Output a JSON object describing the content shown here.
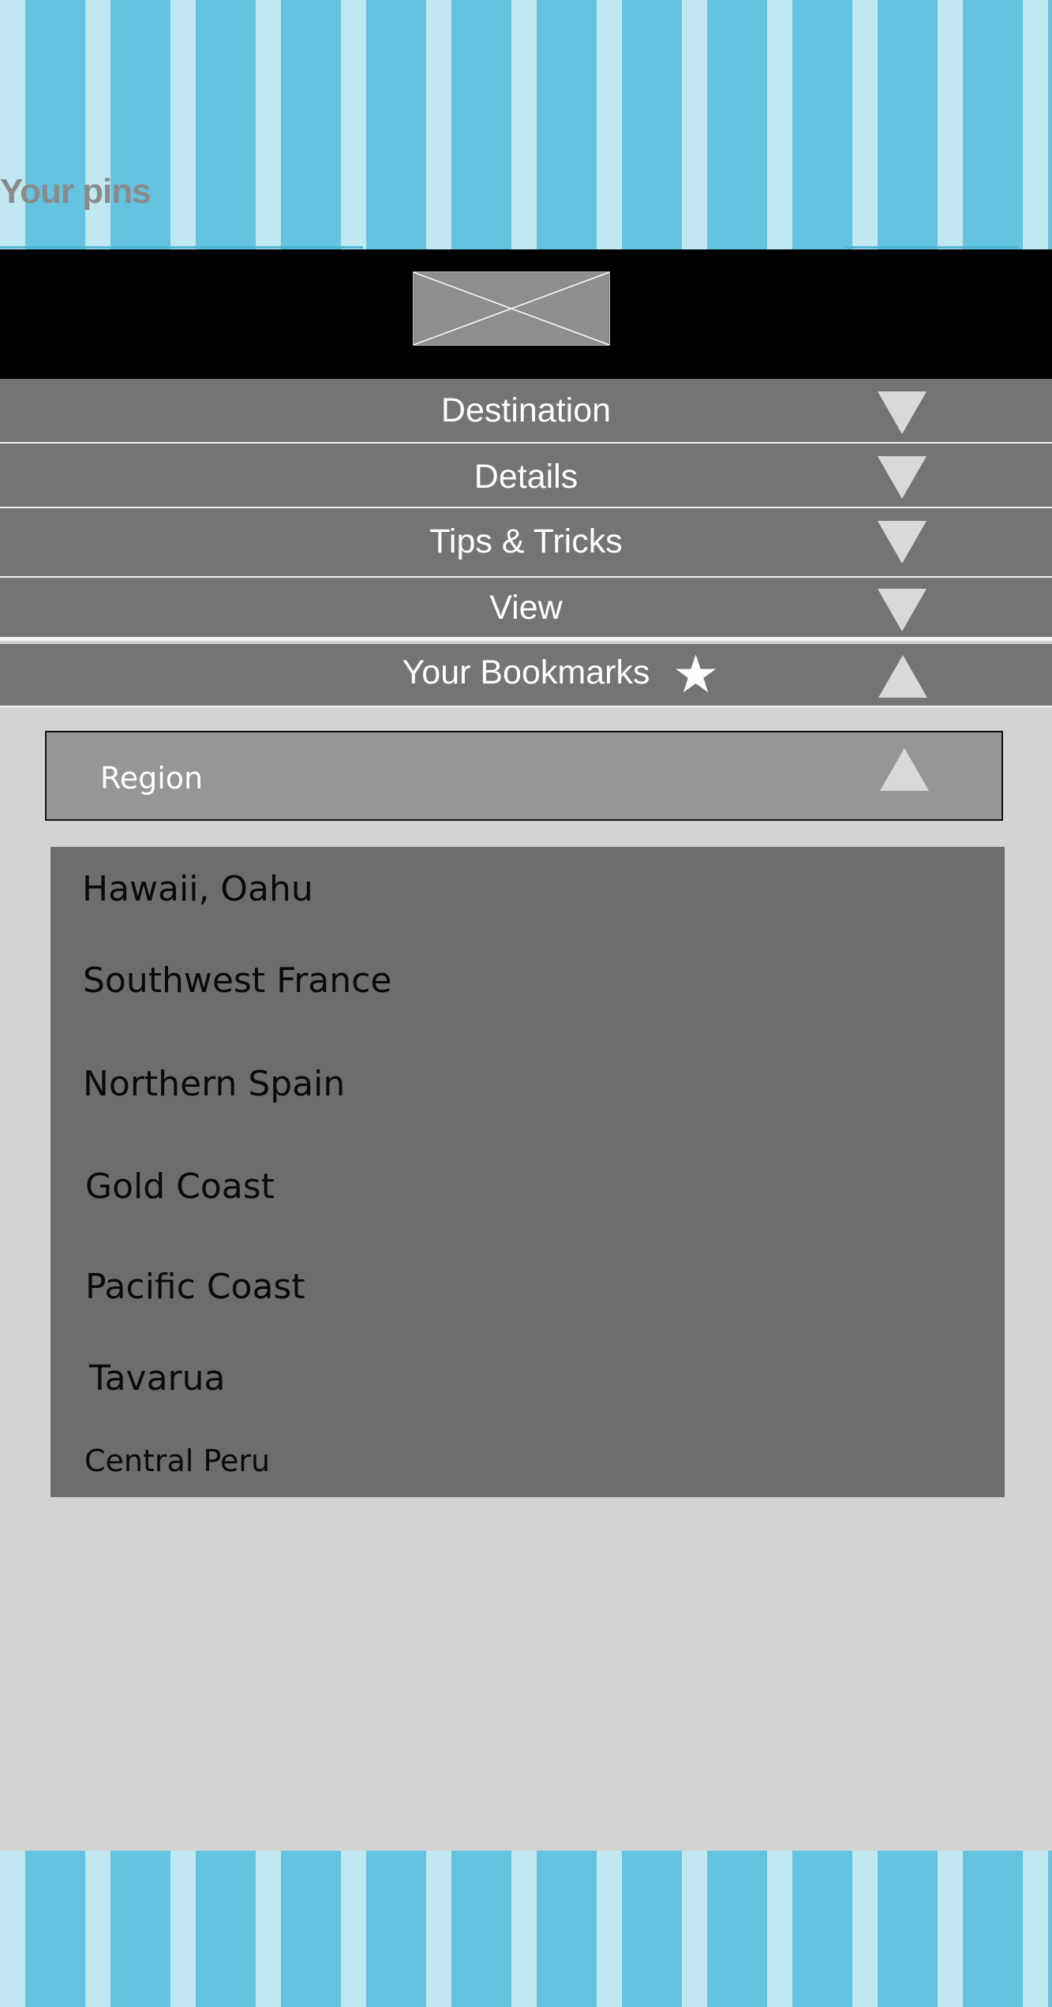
{
  "page": {
    "title": "Your pins"
  },
  "header": {
    "logo_alt": ""
  },
  "menu": {
    "items": [
      {
        "label": "Destination",
        "state": "collapsed"
      },
      {
        "label": "Details",
        "state": "collapsed"
      },
      {
        "label": "Tips & Tricks",
        "state": "collapsed"
      },
      {
        "label": "View",
        "state": "collapsed"
      },
      {
        "label": "Your Bookmarks",
        "state": "expanded",
        "icon": "star-icon"
      }
    ]
  },
  "bookmarks": {
    "region": {
      "label": "Region",
      "state": "expanded"
    },
    "regions": [
      "Hawaii, Oahu",
      "Southwest France",
      "Northern Spain",
      "Gold Coast",
      "Pacific Coast",
      "Tavarua",
      "Central Peru"
    ]
  },
  "colors": {
    "stripe_light": "#c1e7f1",
    "stripe_dark": "#64c3de",
    "menu_bg": "#747474",
    "panel_bg": "#d3d3d3",
    "list_bg": "#6d6d6d"
  }
}
